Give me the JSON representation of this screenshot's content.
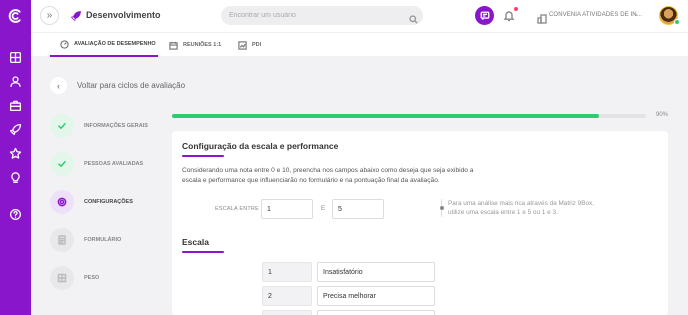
{
  "rail": {
    "icons": [
      "logo-icon",
      "dashboard-icon",
      "user-icon",
      "briefcase-icon",
      "rocket-icon",
      "star-icon",
      "lightbulb-icon",
      "help-icon"
    ]
  },
  "header": {
    "title": "Desenvolvimento",
    "search_placeholder": "Encontrar um usuário",
    "company": "CONVENIA ATIVIDADES DE IN...",
    "notification_dot_color": "#ff3b6b",
    "accent": "#8a16cc"
  },
  "tabs": [
    {
      "label": "AVALIAÇÃO DE DESEMPENHO",
      "icon": "gauge-icon",
      "active": true
    },
    {
      "label": "REUNIÕES 1:1",
      "icon": "calendar-icon",
      "active": false
    },
    {
      "label": "PDI",
      "icon": "chart-icon",
      "active": false
    }
  ],
  "back": {
    "label": "Voltar para ciclos de avaliação"
  },
  "steps": [
    {
      "label": "INFORMAÇÕES GERAIS",
      "state": "done",
      "icon": "check-icon"
    },
    {
      "label": "PESSOAS AVALIADAS",
      "state": "done",
      "icon": "check-icon"
    },
    {
      "label": "CONFIGURAÇÕES",
      "state": "current",
      "icon": "gear-icon"
    },
    {
      "label": "FORMULÁRIO",
      "state": "pending",
      "icon": "document-icon"
    },
    {
      "label": "PESO",
      "state": "pending",
      "icon": "grid-icon"
    }
  ],
  "progress": {
    "value": 90,
    "label": "90%",
    "color": "#2ecc71"
  },
  "config": {
    "title": "Configuração da escala e performance",
    "description": "Considerando uma nota entre 0 e 10, preencha nos campos abaixo como deseja que seja exibido a escala e performance que influenciarão no formulário e na pontuação final da avaliação.",
    "scale_label": "ESCALA ENTRE",
    "min": "1",
    "connector": "E",
    "max": "5",
    "tip": "Para uma análise mais rica através da Matriz 9Box, utilize uma escala entre 1 e 5 ou 1 e 3."
  },
  "scale": {
    "title": "Escala",
    "rows": [
      {
        "value": "1",
        "label": "Insatisfatório"
      },
      {
        "value": "2",
        "label": "Precisa melhorar"
      }
    ]
  }
}
